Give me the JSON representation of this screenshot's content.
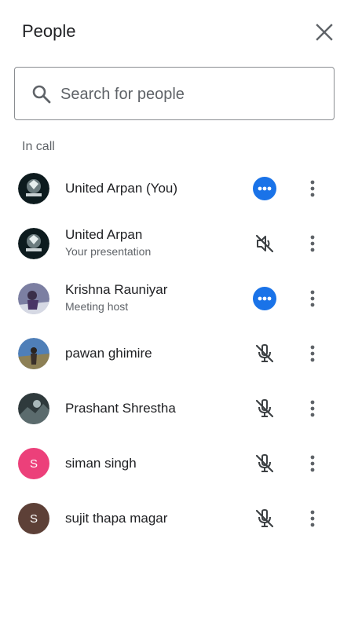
{
  "panel": {
    "title": "People",
    "close_icon": "close-icon"
  },
  "search": {
    "placeholder": "Search for people",
    "value": "",
    "icon": "search-icon"
  },
  "section": {
    "label": "In call"
  },
  "participants": [
    {
      "name": "United Arpan (You)",
      "subtitle": "",
      "avatar_type": "image",
      "avatar_initial": "",
      "avatar_color": "#0d1b1e",
      "status": "active-dots",
      "status_color": "#1a73e8"
    },
    {
      "name": "United Arpan",
      "subtitle": "Your presentation",
      "avatar_type": "image",
      "avatar_initial": "",
      "avatar_color": "#0d1b1e",
      "status": "volume-off",
      "status_color": "#3c4043"
    },
    {
      "name": "Krishna Rauniyar",
      "subtitle": "Meeting host",
      "avatar_type": "image",
      "avatar_initial": "",
      "avatar_color": "#7c7fa2",
      "status": "active-dots",
      "status_color": "#1a73e8"
    },
    {
      "name": "pawan ghimire",
      "subtitle": "",
      "avatar_type": "image",
      "avatar_initial": "",
      "avatar_color": "#4f7fb8",
      "status": "mic-off",
      "status_color": "#3c4043"
    },
    {
      "name": "Prashant Shrestha",
      "subtitle": "",
      "avatar_type": "image",
      "avatar_initial": "",
      "avatar_color": "#2f3a3c",
      "status": "mic-off",
      "status_color": "#3c4043"
    },
    {
      "name": "siman singh",
      "subtitle": "",
      "avatar_type": "initial",
      "avatar_initial": "S",
      "avatar_color": "#ec407a",
      "status": "mic-off",
      "status_color": "#3c4043"
    },
    {
      "name": "sujit thapa magar",
      "subtitle": "",
      "avatar_type": "initial",
      "avatar_initial": "S",
      "avatar_color": "#5d4037",
      "status": "mic-off",
      "status_color": "#3c4043"
    }
  ]
}
